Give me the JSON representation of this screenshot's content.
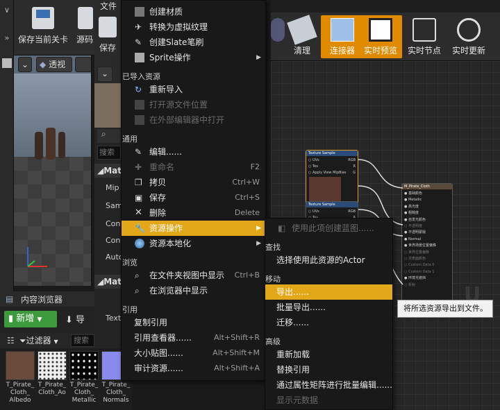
{
  "toolbar": {
    "save_level": "保存当前关卡",
    "source_partial": "源码",
    "save_partial": "保存"
  },
  "menubar": {
    "file": "文件"
  },
  "viewport": {
    "view_mode": "透视"
  },
  "details": {
    "search_placeholder": "搜索",
    "mat_header": "Mat",
    "rows": [
      "Mip",
      "Sam",
      "Con",
      "Con",
      "Auto"
    ],
    "mat_header2": "Mat",
    "text_label": "Text"
  },
  "graph_toolbar": {
    "buttons": [
      {
        "label": "清理",
        "active": false
      },
      {
        "label": "连接器",
        "active": true
      },
      {
        "label": "实时预览",
        "active": true
      },
      {
        "label": "实时节点",
        "active": false
      },
      {
        "label": "实时更新",
        "active": false
      }
    ]
  },
  "graph_nodes": {
    "texture_sample_1": {
      "title": "Texture Sample",
      "pins": [
        "UVs",
        "Tex",
        "Apply View MipBias"
      ],
      "outputs": [
        "RGB",
        "R",
        "G",
        "B",
        "A",
        "RGBA"
      ]
    },
    "texture_sample_2": {
      "title": "Texture Sample",
      "pins": [
        "UVs",
        "Tex"
      ],
      "outputs": [
        "RGB",
        "R"
      ]
    },
    "material": {
      "title": "M_Pirate_Cloth",
      "pins": [
        "基础颜色",
        "Metallic",
        "高光度",
        "粗糙度",
        "自发光颜色",
        "不透明度",
        "不透明蒙版",
        "Normal",
        "世界场景位置偏移",
        "世界位置偏移",
        "次表面颜色",
        "Custom Data 0",
        "Custom Data 1",
        "环境光遮挡",
        "折射"
      ]
    }
  },
  "content_browser": {
    "tab_label": "内容浏览器",
    "add_new": "新增",
    "import_partial": "导",
    "filters": "过滤器",
    "search_partial": "搜索",
    "assets": [
      {
        "name": "T_Pirate_Cloth_Albedo",
        "line1": "T_Pirate_",
        "line2": "Cloth_",
        "line3": "Albedo"
      },
      {
        "name": "T_Pirate_Cloth_Ao",
        "line1": "T_Pirate_",
        "line2": "Cloth_Ao",
        "line3": ""
      },
      {
        "name": "T_Pirate_Cloth_Metallic",
        "line1": "T_Pirate_",
        "line2": "Cloth_",
        "line3": "Metallic"
      },
      {
        "name": "T_Pirate_Cloth_Normals",
        "line1": "T_Pirate_",
        "line2": "Cloth_",
        "line3": "Normals"
      }
    ]
  },
  "context_menu": {
    "items_top": [
      {
        "label": "创建材质",
        "icon": "material-icon"
      },
      {
        "label": "转换为虚拟纹理",
        "icon": "virtual-texture-icon"
      },
      {
        "label": "创建Slate笔刷",
        "icon": "brush-icon"
      },
      {
        "label": "Sprite操作",
        "icon": "sprite-icon",
        "submenu": true
      }
    ],
    "section_imported": "已导入资源",
    "imported": [
      {
        "label": "重新导入",
        "icon": "reimport-icon",
        "disabled": false
      },
      {
        "label": "打开源文件位置",
        "icon": "folder-icon",
        "disabled": true
      },
      {
        "label": "在外部编辑器中打开",
        "icon": "external-editor-icon",
        "disabled": true
      }
    ],
    "section_common": "通用",
    "common": [
      {
        "label": "编辑......",
        "icon": "edit-icon",
        "shortcut": "",
        "disabled": false
      },
      {
        "label": "重命名",
        "icon": "rename-icon",
        "shortcut": "F2",
        "disabled": true
      },
      {
        "label": "拷贝",
        "icon": "copy-icon",
        "shortcut": "Ctrl+W",
        "disabled": false
      },
      {
        "label": "保存",
        "icon": "save-icon",
        "shortcut": "Ctrl+S",
        "disabled": false
      },
      {
        "label": "删除",
        "icon": "delete-icon",
        "shortcut": "Delete",
        "disabled": false
      },
      {
        "label": "资源操作",
        "icon": "wrench-icon",
        "shortcut": "",
        "highlighted": true,
        "submenu": true
      },
      {
        "label": "资源本地化",
        "icon": "globe-icon",
        "shortcut": "",
        "submenu": true
      }
    ],
    "section_browse": "浏览",
    "browse": [
      {
        "label": "在文件夹视图中显示",
        "icon": "search-icon",
        "shortcut": "Ctrl+B"
      },
      {
        "label": "在浏览器中显示",
        "icon": "search-icon",
        "shortcut": ""
      }
    ],
    "section_reference": "引用",
    "reference": [
      {
        "label": "复制引用",
        "shortcut": ""
      },
      {
        "label": "引用查看器......",
        "shortcut": "Alt+Shift+R"
      },
      {
        "label": "大小贴图......",
        "shortcut": "Alt+Shift+M"
      },
      {
        "label": "审计资源......",
        "shortcut": "Alt+Shift+A"
      }
    ]
  },
  "submenu": {
    "create_blueprint": "使用此项创建蓝图......",
    "section_find": "查找",
    "select_actors": "选择使用此资源的Actor",
    "section_move": "移动",
    "export": "导出......",
    "bulk_export": "批量导出......",
    "migrate": "迁移......",
    "section_advanced": "高级",
    "reload": "重新加载",
    "replace_refs": "替换引用",
    "bulk_edit": "通过属性矩阵进行批量编辑......",
    "show_metadata": "显示元数据"
  },
  "tooltip": {
    "text": "将所选资源导出到文件。"
  },
  "colors": {
    "highlight": "#e3a71a",
    "active_button": "#e08a00",
    "add_button": "#3c9a3c"
  }
}
